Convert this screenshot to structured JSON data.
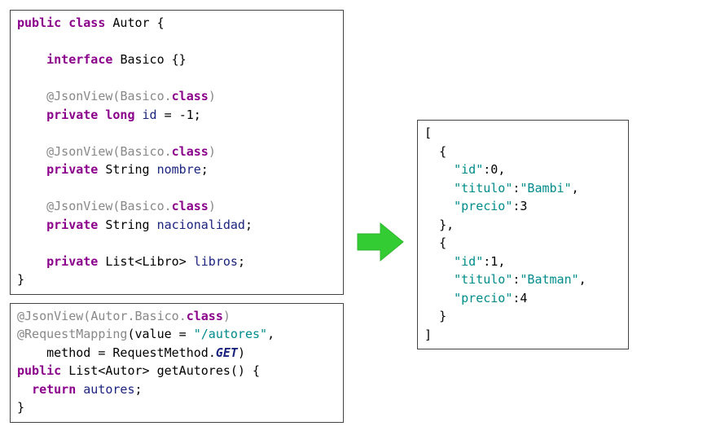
{
  "autor_class": {
    "kw_public": "public",
    "kw_class": "class",
    "class_name": "Autor",
    "open_brace": "{",
    "kw_interface": "interface",
    "iface_name": "Basico",
    "iface_braces": "{}",
    "ann_jsonview": "@JsonView",
    "ann_open": "(",
    "ann_basico": "Basico",
    "ann_dot": ".",
    "ann_classkw": "class",
    "ann_close": ")",
    "kw_private": "private",
    "kw_long": "long",
    "fld_id": "id",
    "eq": " = ",
    "val_neg1": "-1",
    "semi": ";",
    "type_string": "String",
    "fld_nombre": "nombre",
    "fld_nacionalidad": "nacionalidad",
    "type_list_open": "List<",
    "type_libro": "Libro",
    "type_list_close": ">",
    "fld_libros": "libros",
    "close_brace": "}"
  },
  "controller": {
    "ann_jsonview": "@JsonView",
    "open_p": "(",
    "autor_basico": "Autor.Basico",
    "dot": ".",
    "classkw": "class",
    "close_p": ")",
    "ann_reqmap": "@RequestMapping",
    "value_key": "value = ",
    "value_str": "\"/autores\"",
    "comma": ",",
    "method_key": "method = ",
    "reqmethod": "RequestMethod",
    "get_enum": "GET",
    "kw_public": "public",
    "ret_list_open": "List<",
    "ret_autor": "Autor",
    "ret_list_close": ">",
    "method_name": "getAutores",
    "parens": "()",
    "open_brace": " {",
    "kw_return": "return",
    "var_autores": "autores",
    "semi": ";",
    "close_brace": "}"
  },
  "json_output": {
    "open_arr": "[",
    "open_obj": "{",
    "key_id": "\"id\"",
    "colon": ":",
    "v_id0": "0",
    "comma": ",",
    "key_titulo": "\"titulo\"",
    "v_titulo0": "\"Bambi\"",
    "key_precio": "\"precio\"",
    "v_precio0": "3",
    "close_obj": "}",
    "v_id1": "1",
    "v_titulo1": "\"Batman\"",
    "v_precio1": "4",
    "close_arr": "]"
  }
}
